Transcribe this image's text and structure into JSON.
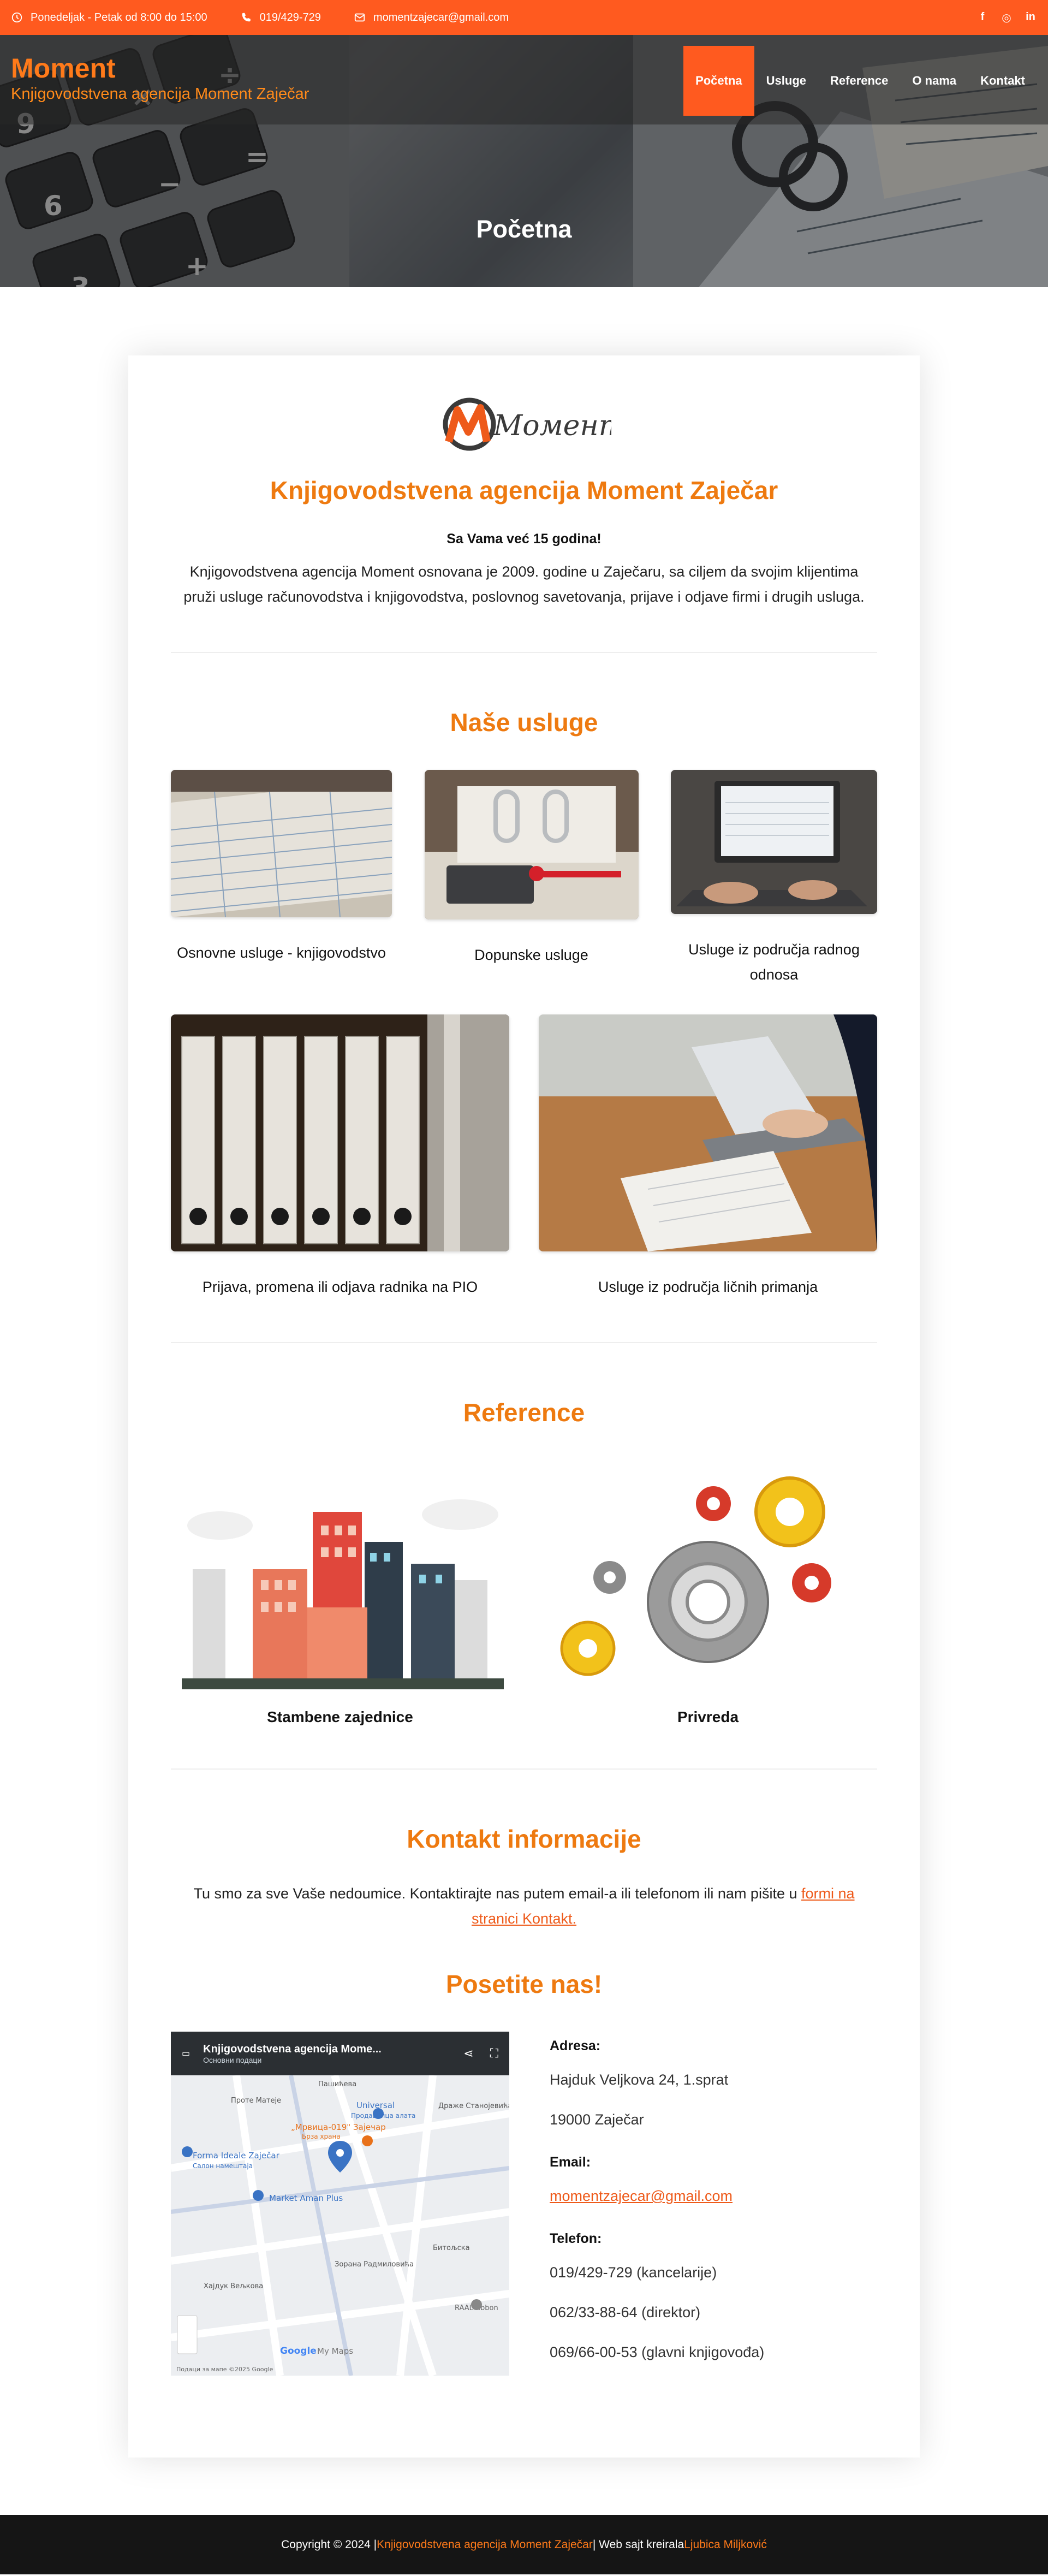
{
  "topbar": {
    "hours": "Ponedeljak - Petak od 8:00 do 15:00",
    "phone": "019/429-729",
    "email": "momentzajecar@gmail.com",
    "social": [
      "facebook-icon",
      "instagram-icon",
      "linkedin-icon"
    ]
  },
  "brand": {
    "name": "Moment",
    "tagline": "Knjigovodstvena agencija Moment Zaječar"
  },
  "nav": [
    "Početna",
    "Usluge",
    "Reference",
    "O nama",
    "Kontakt"
  ],
  "hero": {
    "title": "Početna"
  },
  "intro": {
    "logo_text": "Момент",
    "title": "Knjigovodstvena agencija Moment Zaječar",
    "highlight": "Sa Vama već 15 godina!",
    "text": "Knjigovodstvena agencija Moment osnovana je 2009. godine u Zaječaru, sa ciljem da svojim klijentima pruži usluge računovodstva i knjigovodstva, poslovnog savetovanja, prijave i odjave firmi i drugih usluga."
  },
  "services": {
    "title": "Naše usluge",
    "items": [
      "Osnovne usluge - knjigovodstvo",
      "Dopunske usluge",
      "Usluge iz područja radnog odnosa",
      "Prijava, promena ili odjava radnika na PIO",
      "Usluge iz područja ličnih primanja"
    ]
  },
  "references": {
    "title": "Reference",
    "items": [
      "Stambene zajednice",
      "Privreda"
    ]
  },
  "contact": {
    "title": "Kontakt informacije",
    "text_before": "Tu smo za sve Vaše nedoumice. Kontaktirajte nas putem email-a ili telefonom ili nam pišite u ",
    "link": "formi na stranici Kontakt.",
    "visit_title": "Posetite nas!"
  },
  "map": {
    "title": "Knjigovodstvena agencija Mome...",
    "subtitle": "Основни подаци",
    "labels": [
      "Universal",
      "Продавница алата",
      "Forma Ideale Zaječar",
      "Салон намештаја",
      "„Мрвица-019\" Зајечар",
      "Брза храна",
      "Market Aman Plus",
      "RAAL ribbon",
      "Google",
      "My Maps",
      "Проте Матеје",
      "Пашићева",
      "Хајдук Вељкова",
      "Зорана Радмиловића",
      "Битољска",
      "Драже Станојевића"
    ],
    "footer_note": "Подаци за мапе ©2025 Google"
  },
  "address": {
    "addr_label": "Adresa:",
    "street": "Hajduk Veljkova 24, 1.sprat",
    "city": "19000 Zaječar",
    "email_label": "Email:",
    "email": "momentzajecar@gmail.com",
    "phone_label": "Telefon:",
    "phones": [
      "019/429-729 (kancelarije)",
      "062/33-88-64 (direktor)",
      "069/66-00-53 (glavni knjigovođa)"
    ]
  },
  "footer": {
    "copyright": "Copyright © 2024 | ",
    "agency": "Knjigovodstvena agencija Moment Zaječar",
    "middle": " | Web sajt kreirala ",
    "author": "Ljubica Miljković"
  },
  "colors": {
    "accent": "#ff5a1f",
    "heading": "#ee7a10",
    "footer": "#151515"
  }
}
